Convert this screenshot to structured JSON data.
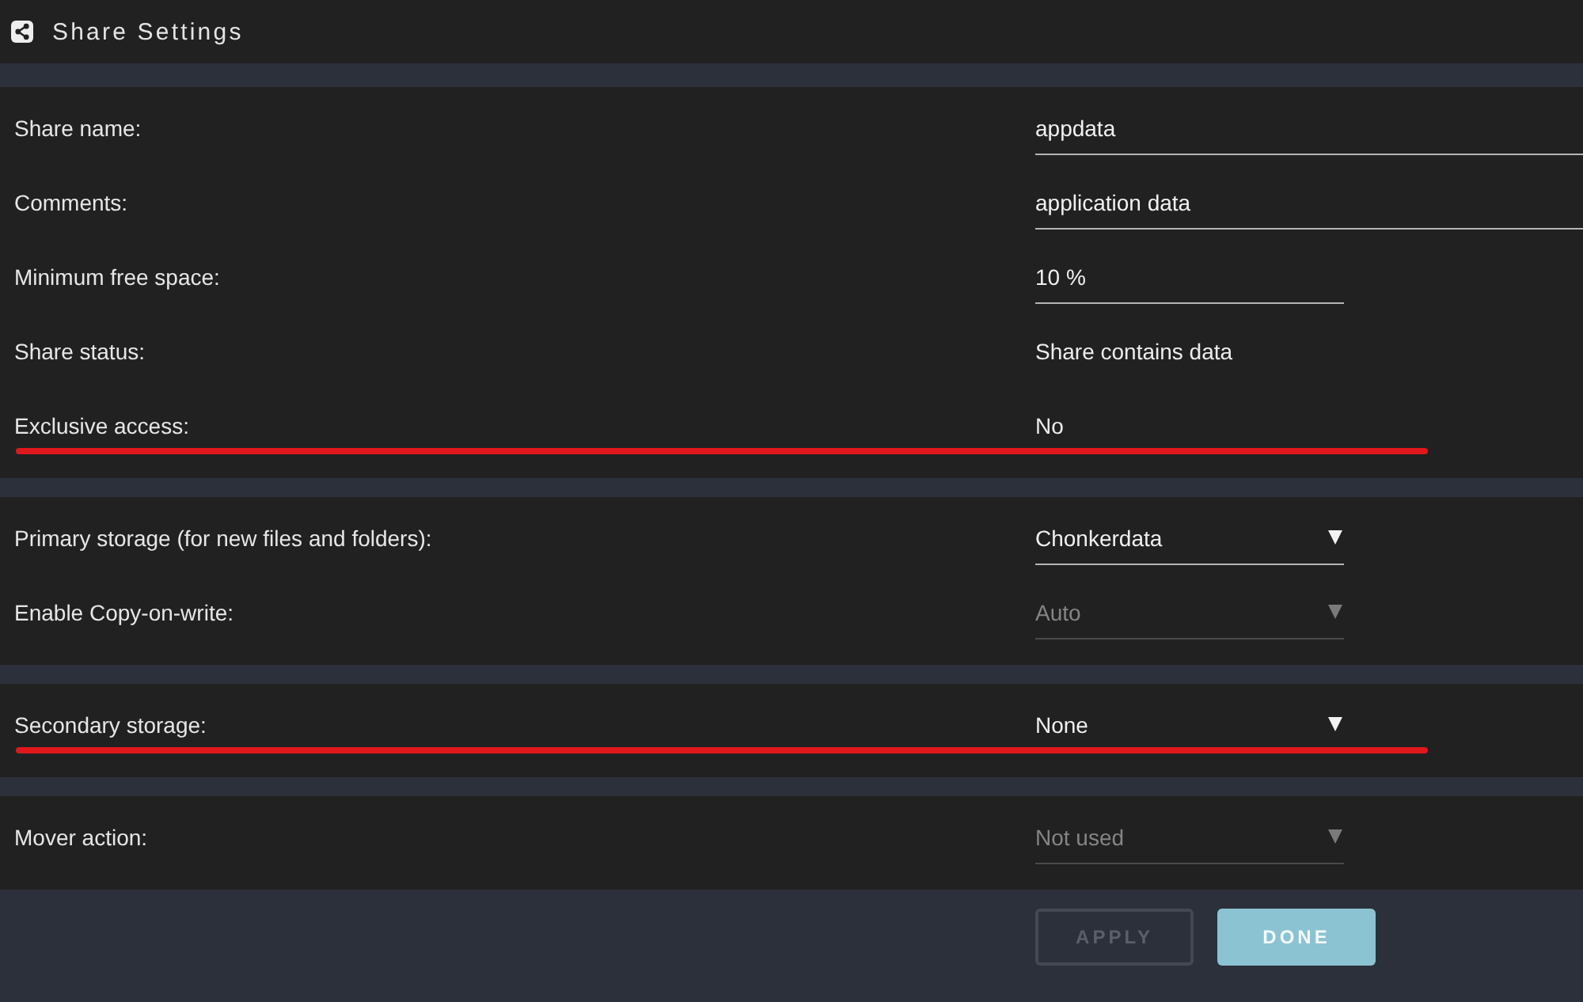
{
  "header": {
    "title": "Share Settings"
  },
  "sections": [
    {
      "rows": [
        {
          "label": "Share name:",
          "kind": "longtext",
          "value": "appdata",
          "disabled": false,
          "underlined": false
        },
        {
          "label": "Comments:",
          "kind": "longtext",
          "value": "application data",
          "disabled": false,
          "underlined": false
        },
        {
          "label": "Minimum free space:",
          "kind": "text",
          "value": "10 %",
          "disabled": false,
          "underlined": false
        },
        {
          "label": "Share status:",
          "kind": "info",
          "value": "Share contains data",
          "disabled": false,
          "underlined": false
        },
        {
          "label": "Exclusive access:",
          "kind": "info",
          "value": "No",
          "disabled": false,
          "underlined": true
        }
      ]
    },
    {
      "rows": [
        {
          "label": "Primary storage (for new files and folders):",
          "kind": "select",
          "value": "Chonkerdata",
          "disabled": false,
          "underlined": false
        },
        {
          "label": "Enable Copy-on-write:",
          "kind": "select",
          "value": "Auto",
          "disabled": true,
          "underlined": false
        }
      ]
    },
    {
      "rows": [
        {
          "label": "Secondary storage:",
          "kind": "select",
          "value": "None",
          "disabled": false,
          "underlined": true
        }
      ]
    },
    {
      "rows": [
        {
          "label": "Mover action:",
          "kind": "select",
          "value": "Not used",
          "disabled": true,
          "underlined": false
        }
      ]
    }
  ],
  "buttons": [
    {
      "label": "APPLY",
      "kind": "secondary",
      "disabled": true
    },
    {
      "label": "DONE",
      "kind": "primary",
      "disabled": false
    }
  ]
}
